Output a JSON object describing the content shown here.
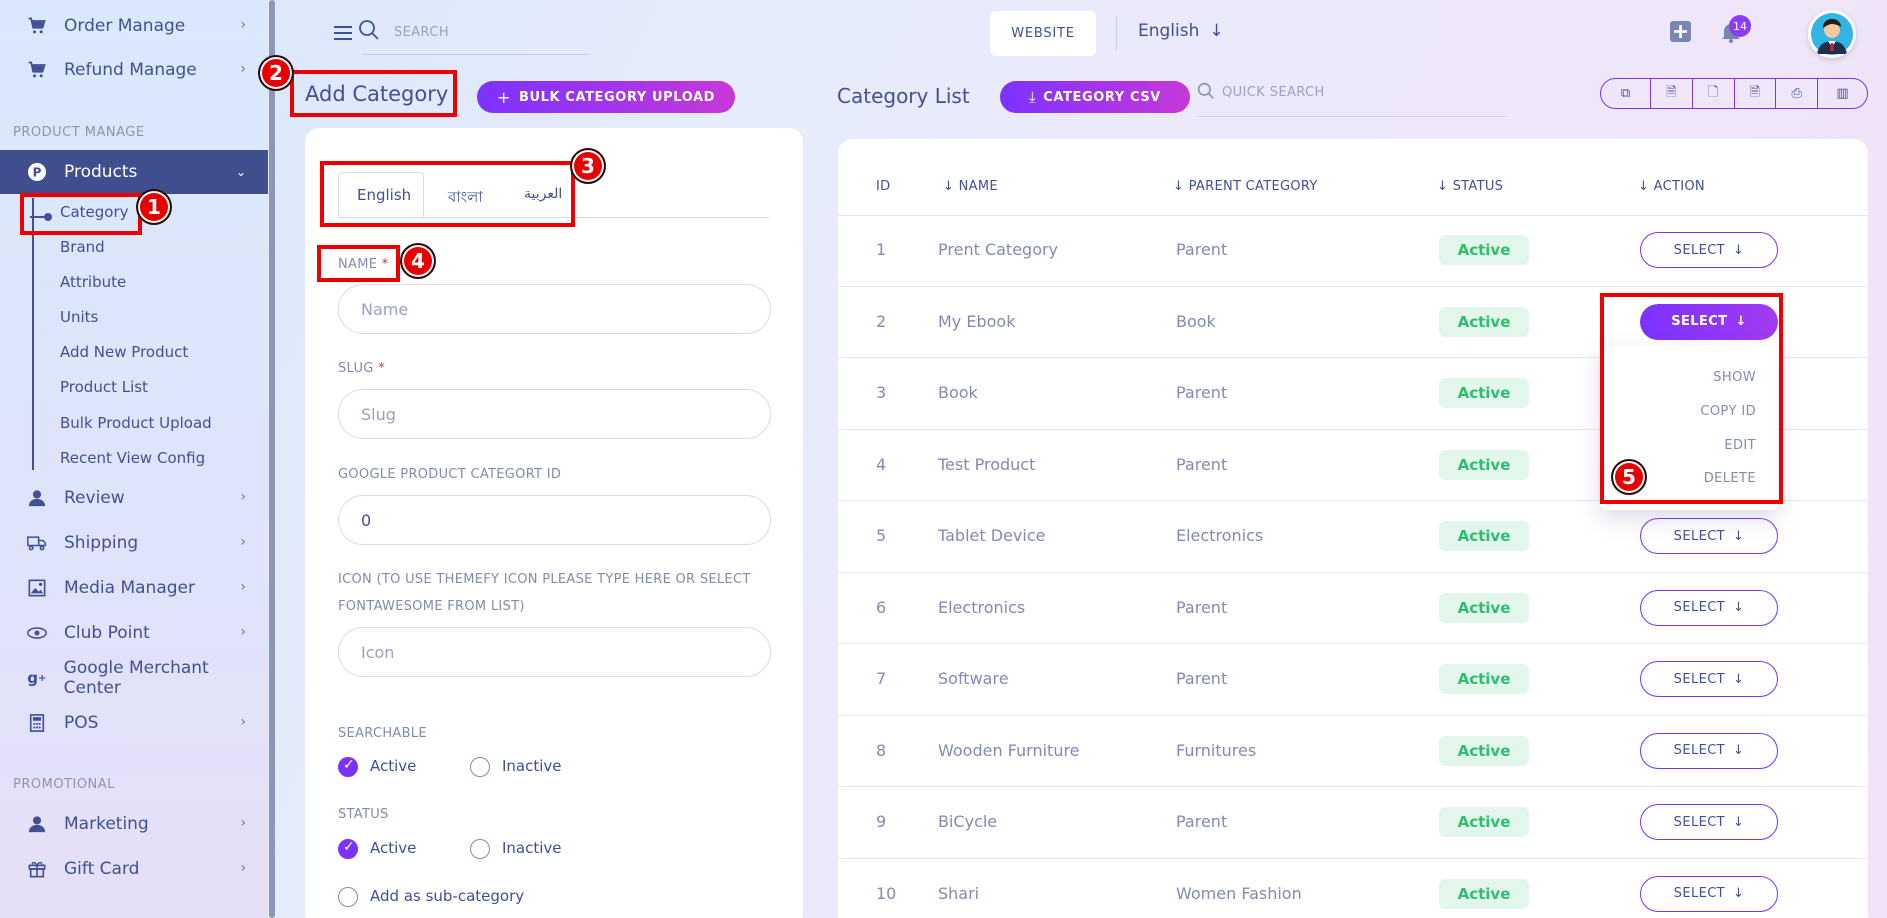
{
  "sidebar": {
    "top_items": [
      {
        "label": "Order Manage",
        "icon": "cart-icon"
      },
      {
        "label": "Refund Manage",
        "icon": "cart-icon"
      }
    ],
    "section_product": "PRODUCT MANAGE",
    "products_label": "Products",
    "sub_items": [
      "Category",
      "Brand",
      "Attribute",
      "Units",
      "Add New Product",
      "Product List",
      "Bulk Product Upload",
      "Recent View Config"
    ],
    "mid_items": [
      {
        "label": "Review"
      },
      {
        "label": "Shipping"
      },
      {
        "label": "Media Manager"
      },
      {
        "label": "Club Point"
      },
      {
        "label": "Google Merchant Center"
      },
      {
        "label": "POS"
      }
    ],
    "section_promotional": "PROMOTIONAL",
    "promo_items": [
      {
        "label": "Marketing"
      },
      {
        "label": "Gift Card"
      }
    ]
  },
  "topbar": {
    "search_placeholder": "SEARCH",
    "website_label": "WEBSITE",
    "language": "English",
    "notification_count": "14"
  },
  "add_category": {
    "title": "Add Category",
    "bulk_upload_label": "BULK CATEGORY UPLOAD",
    "tabs": [
      "English",
      "বাংলা",
      "العربية"
    ],
    "name_label": "NAME",
    "name_placeholder": "Name",
    "slug_label": "SLUG",
    "slug_placeholder": "Slug",
    "google_label": "GOOGLE PRODUCT CATEGORT ID",
    "google_value": "0",
    "icon_label_1": "ICON (TO USE THEMEFY ICON PLEASE TYPE HERE OR SELECT",
    "icon_label_2": "FONTAWESOME FROM LIST)",
    "icon_placeholder": "Icon",
    "searchable_label": "SEARCHABLE",
    "status_label": "STATUS",
    "active_label": "Active",
    "inactive_label": "Inactive",
    "sub_category_label": "Add as sub-category"
  },
  "category_list": {
    "title": "Category List",
    "csv_label": "CATEGORY CSV",
    "quick_search_placeholder": "QUICK SEARCH",
    "headers": {
      "id": "ID",
      "name": "NAME",
      "parent": "PARENT CATEGORY",
      "status": "STATUS",
      "action": "ACTION"
    },
    "select_label": "SELECT",
    "rows": [
      {
        "id": "1",
        "name": "Prent Category",
        "parent": "Parent",
        "status": "Active"
      },
      {
        "id": "2",
        "name": "My Ebook",
        "parent": "Book",
        "status": "Active"
      },
      {
        "id": "3",
        "name": "Book",
        "parent": "Parent",
        "status": "Active"
      },
      {
        "id": "4",
        "name": "Test Product",
        "parent": "Parent",
        "status": "Active"
      },
      {
        "id": "5",
        "name": "Tablet Device",
        "parent": "Electronics",
        "status": "Active"
      },
      {
        "id": "6",
        "name": "Electronics",
        "parent": "Parent",
        "status": "Active"
      },
      {
        "id": "7",
        "name": "Software",
        "parent": "Parent",
        "status": "Active"
      },
      {
        "id": "8",
        "name": "Wooden Furniture",
        "parent": "Furnitures",
        "status": "Active"
      },
      {
        "id": "9",
        "name": "BiCycle",
        "parent": "Parent",
        "status": "Active"
      },
      {
        "id": "10",
        "name": "Shari",
        "parent": "Women Fashion",
        "status": "Active"
      }
    ],
    "dropdown": [
      "SHOW",
      "COPY ID",
      "EDIT",
      "DELETE"
    ]
  },
  "annotations": [
    "1",
    "2",
    "3",
    "4",
    "5"
  ]
}
